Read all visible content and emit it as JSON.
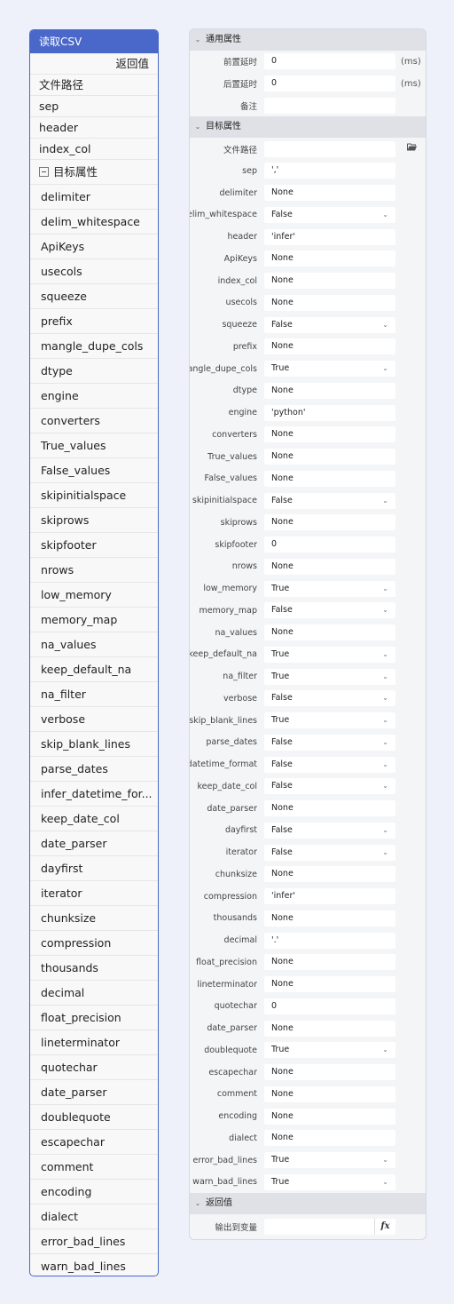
{
  "node": {
    "title": "读取CSV",
    "return_label": "返回值",
    "basic_rows": [
      "文件路径",
      "sep",
      "header",
      "index_col"
    ],
    "section_label": "目标属性",
    "rows": [
      "delimiter",
      "delim_whitespace",
      "ApiKeys",
      "usecols",
      "squeeze",
      "prefix",
      "mangle_dupe_cols",
      "dtype",
      "engine",
      "converters",
      "True_values",
      "False_values",
      "skipinitialspace",
      "skiprows",
      "skipfooter",
      "nrows",
      "low_memory",
      "memory_map",
      "na_values",
      "keep_default_na",
      "na_filter",
      "verbose",
      "skip_blank_lines",
      "parse_dates",
      "infer_datetime_for...",
      "keep_date_col",
      "date_parser",
      "dayfirst",
      "iterator",
      "chunksize",
      "compression",
      "thousands",
      "decimal",
      "float_precision",
      "lineterminator",
      "quotechar",
      "date_parser",
      "doublequote",
      "escapechar",
      "comment",
      "encoding",
      "dialect",
      "error_bad_lines",
      "warn_bad_lines"
    ]
  },
  "props": {
    "general": {
      "title": "通用属性",
      "rows": [
        {
          "label": "前置延时",
          "value": "0",
          "unit": "(ms)"
        },
        {
          "label": "后置延时",
          "value": "0",
          "unit": "(ms)"
        },
        {
          "label": "备注",
          "value": ""
        }
      ]
    },
    "target": {
      "title": "目标属性",
      "file_path_label": "文件路径",
      "file_path_value": "",
      "rows": [
        {
          "label": "sep",
          "value": "','",
          "dropdown": false
        },
        {
          "label": "delimiter",
          "value": "None",
          "dropdown": false
        },
        {
          "label": "delim_whitespace",
          "value": "False",
          "dropdown": true
        },
        {
          "label": "header",
          "value": "'infer'",
          "dropdown": false
        },
        {
          "label": "ApiKeys",
          "value": "None",
          "dropdown": false
        },
        {
          "label": "index_col",
          "value": "None",
          "dropdown": false
        },
        {
          "label": "usecols",
          "value": "None",
          "dropdown": false
        },
        {
          "label": "squeeze",
          "value": "False",
          "dropdown": true
        },
        {
          "label": "prefix",
          "value": "None",
          "dropdown": false
        },
        {
          "label": "mangle_dupe_cols",
          "value": "True",
          "dropdown": true
        },
        {
          "label": "dtype",
          "value": "None",
          "dropdown": false
        },
        {
          "label": "engine",
          "value": "'python'",
          "dropdown": false
        },
        {
          "label": "converters",
          "value": "None",
          "dropdown": false
        },
        {
          "label": "True_values",
          "value": "None",
          "dropdown": false
        },
        {
          "label": "False_values",
          "value": "None",
          "dropdown": false
        },
        {
          "label": "skipinitialspace",
          "value": "False",
          "dropdown": true
        },
        {
          "label": "skiprows",
          "value": "None",
          "dropdown": false
        },
        {
          "label": "skipfooter",
          "value": "0",
          "dropdown": false
        },
        {
          "label": "nrows",
          "value": "None",
          "dropdown": false
        },
        {
          "label": "low_memory",
          "value": "True",
          "dropdown": true
        },
        {
          "label": "memory_map",
          "value": "False",
          "dropdown": true
        },
        {
          "label": "na_values",
          "value": "None",
          "dropdown": false
        },
        {
          "label": "keep_default_na",
          "value": "True",
          "dropdown": true
        },
        {
          "label": "na_filter",
          "value": "True",
          "dropdown": true
        },
        {
          "label": "verbose",
          "value": "False",
          "dropdown": true
        },
        {
          "label": "skip_blank_lines",
          "value": "True",
          "dropdown": true
        },
        {
          "label": "parse_dates",
          "value": "False",
          "dropdown": true
        },
        {
          "label": "infer_datetime_format",
          "value": "False",
          "dropdown": true
        },
        {
          "label": "keep_date_col",
          "value": "False",
          "dropdown": true
        },
        {
          "label": "date_parser",
          "value": "None",
          "dropdown": false
        },
        {
          "label": "dayfirst",
          "value": "False",
          "dropdown": true
        },
        {
          "label": "iterator",
          "value": "False",
          "dropdown": true
        },
        {
          "label": "chunksize",
          "value": "None",
          "dropdown": false
        },
        {
          "label": "compression",
          "value": "'infer'",
          "dropdown": false
        },
        {
          "label": "thousands",
          "value": "None",
          "dropdown": false
        },
        {
          "label": "decimal",
          "value": "'.'",
          "dropdown": false
        },
        {
          "label": "float_precision",
          "value": "None",
          "dropdown": false
        },
        {
          "label": "lineterminator",
          "value": "None",
          "dropdown": false
        },
        {
          "label": "quotechar",
          "value": "0",
          "dropdown": false
        },
        {
          "label": "date_parser",
          "value": "None",
          "dropdown": false
        },
        {
          "label": "doublequote",
          "value": "True",
          "dropdown": true
        },
        {
          "label": "escapechar",
          "value": "None",
          "dropdown": false
        },
        {
          "label": "comment",
          "value": "None",
          "dropdown": false
        },
        {
          "label": "encoding",
          "value": "None",
          "dropdown": false
        },
        {
          "label": "dialect",
          "value": "None",
          "dropdown": false
        },
        {
          "label": "error_bad_lines",
          "value": "True",
          "dropdown": true
        },
        {
          "label": "warn_bad_lines",
          "value": "True",
          "dropdown": true
        }
      ]
    },
    "output": {
      "title": "返回值",
      "label": "输出到变量",
      "value": "",
      "fx_label": "fx"
    }
  },
  "icons": {
    "section_chevron": "⌄",
    "dropdown_chevron": "⌄"
  }
}
